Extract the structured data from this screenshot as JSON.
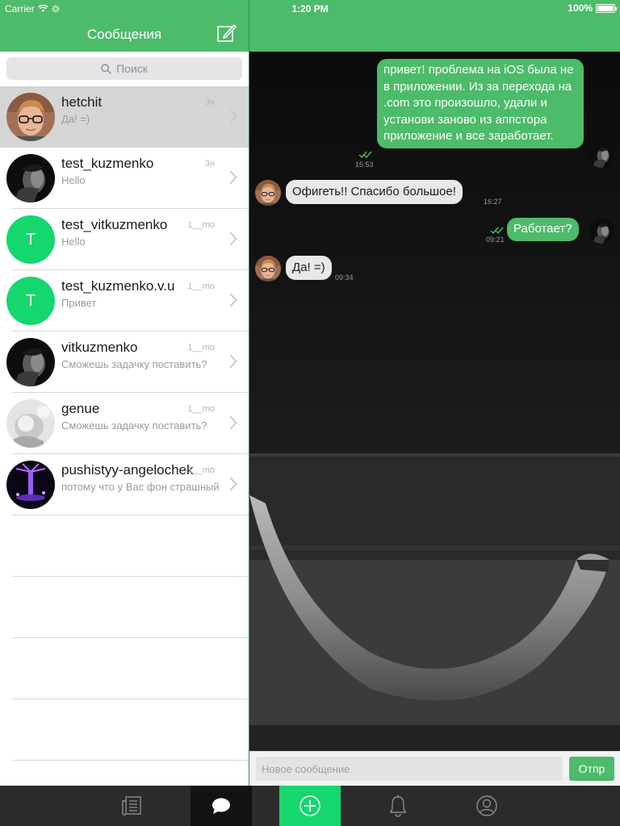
{
  "status_bar": {
    "carrier": "Carrier",
    "time": "1:20 PM",
    "battery": "100%"
  },
  "sidebar": {
    "title": "Сообщения",
    "search_placeholder": "Поиск",
    "conversations": [
      {
        "name": "hetchit",
        "preview": "Да! =)",
        "time": "3ч",
        "avatar": "photo-glasses-man",
        "active": true
      },
      {
        "name": "test_kuzmenko",
        "preview": "Hello",
        "time": "3н",
        "avatar": "photo-dark-portrait",
        "active": false
      },
      {
        "name": "test_vitkuzmenko",
        "preview": "Hello",
        "time": "1__mo",
        "avatar": "letter",
        "letter": "T",
        "active": false
      },
      {
        "name": "test_kuzmenko.v.u",
        "preview": "Привет",
        "time": "1__mo",
        "avatar": "letter",
        "letter": "T",
        "active": false
      },
      {
        "name": "vitkuzmenko",
        "preview": "Сможешь задачку поставить?",
        "time": "1__mo",
        "avatar": "photo-dark-portrait",
        "active": false
      },
      {
        "name": "genue",
        "preview": "Сможешь задачку поставить?",
        "time": "1__mo",
        "avatar": "photo-light-baby",
        "active": false
      },
      {
        "name": "pushistyy-angelochek",
        "preview": "потому что у Вас фон страшный",
        "time": "1__mo",
        "avatar": "photo-purple-light",
        "active": false
      }
    ]
  },
  "chat": {
    "messages": [
      {
        "direction": "out",
        "text": "привет! проблема на iOS была не в приложении. Из за перехода на .com это произошло, удали и установи заново из аппстора приложение и все заработает.",
        "time": "15:53",
        "read": true
      },
      {
        "direction": "in",
        "text": "Офигеть!! Спасибо большое!",
        "time": "16:27"
      },
      {
        "direction": "out",
        "text": "Работает?",
        "time": "09:21",
        "read": true
      },
      {
        "direction": "in",
        "text": "Да! =)",
        "time": "09:34"
      }
    ],
    "composer_placeholder": "Новое сообщение",
    "send_label": "Отпр"
  },
  "tabbar": {
    "tabs": [
      {
        "icon": "news-icon",
        "active": false
      },
      {
        "icon": "chat-bubble-icon",
        "active": true
      },
      {
        "icon": "plus-circle-icon",
        "active": false
      },
      {
        "icon": "bell-icon",
        "active": false
      },
      {
        "icon": "profile-icon",
        "active": false
      }
    ]
  },
  "colors": {
    "accent_green": "#4cbb6a",
    "bright_green": "#16d66e",
    "tab_bar": "#2b2b2b"
  }
}
